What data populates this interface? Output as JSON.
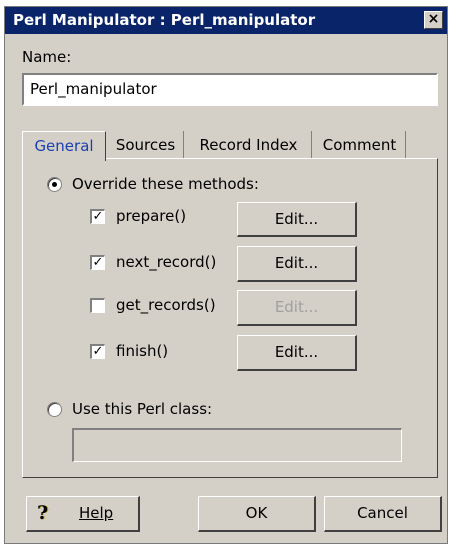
{
  "window": {
    "title": "Perl Manipulator : Perl_manipulator",
    "close_glyph": "×"
  },
  "name": {
    "label": "Name:",
    "value": "Perl_manipulator"
  },
  "tabs": [
    {
      "label": "General",
      "active": true
    },
    {
      "label": "Sources",
      "active": false
    },
    {
      "label": "Record Index",
      "active": false
    },
    {
      "label": "Comment",
      "active": false
    }
  ],
  "general": {
    "override_label": "Override these methods:",
    "override_selected": true,
    "methods": [
      {
        "name": "prepare()",
        "checked": true,
        "edit_label": "Edit...",
        "edit_enabled": true
      },
      {
        "name": "next_record()",
        "checked": true,
        "edit_label": "Edit...",
        "edit_enabled": true
      },
      {
        "name": "get_records()",
        "checked": false,
        "edit_label": "Edit...",
        "edit_enabled": false
      },
      {
        "name": "finish()",
        "checked": true,
        "edit_label": "Edit...",
        "edit_enabled": true
      }
    ],
    "perl_class_label": "Use this Perl class:",
    "perl_class_selected": false,
    "perl_class_value": ""
  },
  "footer": {
    "help_label": "Help",
    "ok_label": "OK",
    "cancel_label": "Cancel"
  },
  "colors": {
    "titlebar": "#0a246a",
    "dialog_bg": "#d4d0c8",
    "active_tab_text": "#1a3fb0"
  },
  "icons": {
    "help": "question-mark-icon",
    "close": "close-icon"
  }
}
